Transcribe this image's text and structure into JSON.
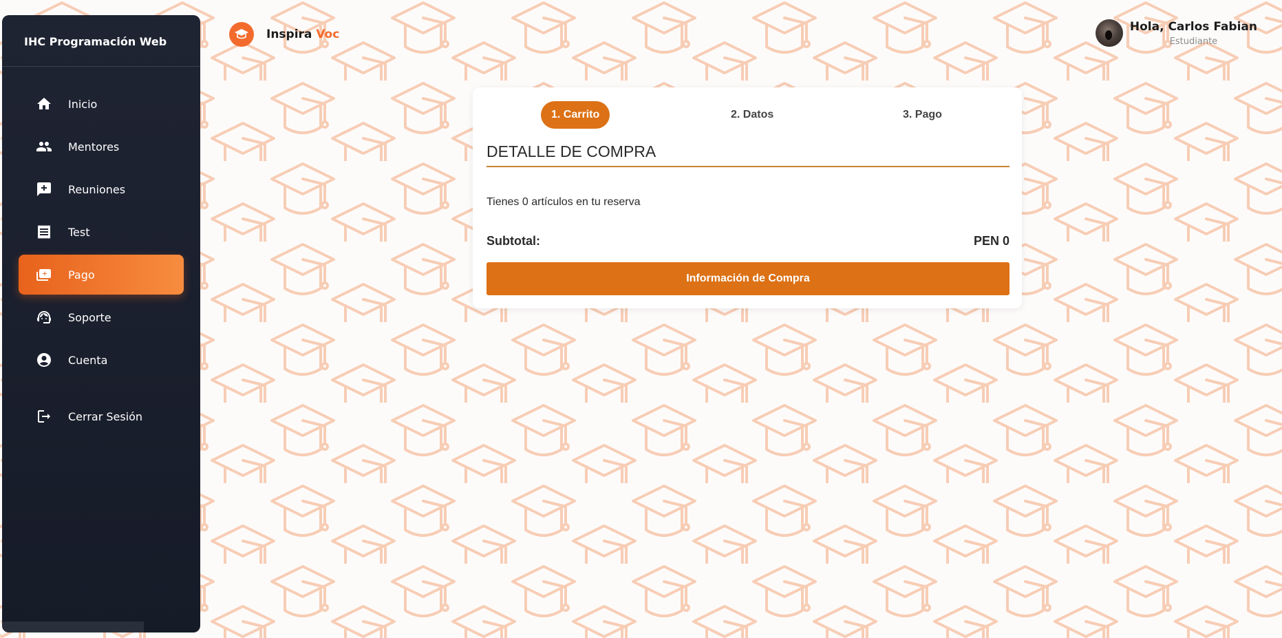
{
  "sidebar": {
    "title": "IHC Programación Web",
    "items": [
      {
        "label": "Inicio",
        "icon": "home-icon"
      },
      {
        "label": "Mentores",
        "icon": "people-icon"
      },
      {
        "label": "Reuniones",
        "icon": "chat-icon"
      },
      {
        "label": "Test",
        "icon": "receipt-icon"
      },
      {
        "label": "Pago",
        "icon": "payment-icon",
        "active": true
      },
      {
        "label": "Soporte",
        "icon": "support-icon"
      },
      {
        "label": "Cuenta",
        "icon": "account-icon"
      },
      {
        "label": "Cerrar Sesión",
        "icon": "logout-icon"
      }
    ]
  },
  "header": {
    "brand": {
      "name": "Inspira",
      "accent": "Voc",
      "logo_text": "Inspiravoc"
    },
    "user": {
      "greeting": "Hola, Carlos Fabian",
      "role": "Estudiante"
    }
  },
  "checkout": {
    "steps": [
      {
        "label": "1. Carrito",
        "active": true
      },
      {
        "label": "2. Datos",
        "active": false
      },
      {
        "label": "3. Pago",
        "active": false
      }
    ],
    "title": "DETALLE DE COMPRA",
    "info": "Tienes 0 artículos en tu reserva",
    "subtotal_label": "Subtotal:",
    "subtotal_value": "PEN 0",
    "button_label": "Información de Compra"
  },
  "colors": {
    "accent": "#dc7115",
    "brand_orange": "#f26b2d",
    "sidebar_bg": "#1b2030",
    "pattern": "#f7cdb5"
  }
}
